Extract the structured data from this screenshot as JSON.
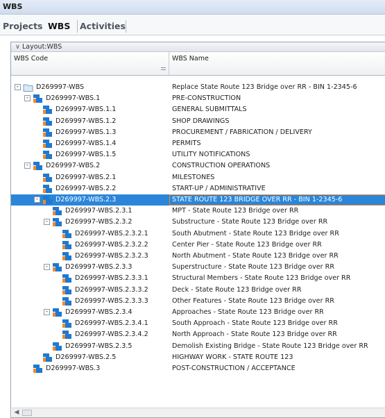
{
  "window": {
    "title": "WBS"
  },
  "tabs": [
    {
      "label": "Projects",
      "active": false
    },
    {
      "label": "WBS",
      "active": true
    },
    {
      "label": "Activities",
      "active": false
    }
  ],
  "panel": {
    "layout_label": "Layout:WBS",
    "columns": {
      "code": "WBS Code",
      "name": "WBS Name"
    }
  },
  "colors": {
    "selection": "#2b86da",
    "selection_outline": "#f08a2c"
  },
  "rows": [
    {
      "code": "D269997-WBS",
      "name": "Replace State Route 123 Bridge over RR - BIN 1-2345-6",
      "level": 0,
      "toggle": "-",
      "icon": "folder-icon",
      "selected": false
    },
    {
      "code": "D269997-WBS.1",
      "name": "PRE-CONSTRUCTION",
      "level": 1,
      "toggle": "-",
      "icon": "wbs-node-icon",
      "selected": false
    },
    {
      "code": "D269997-WBS.1.1",
      "name": "GENERAL SUBMITTALS",
      "level": 2,
      "toggle": "",
      "icon": "wbs-node-icon",
      "selected": false
    },
    {
      "code": "D269997-WBS.1.2",
      "name": "SHOP DRAWINGS",
      "level": 2,
      "toggle": "",
      "icon": "wbs-node-icon",
      "selected": false
    },
    {
      "code": "D269997-WBS.1.3",
      "name": "PROCUREMENT / FABRICATION / DELIVERY",
      "level": 2,
      "toggle": "",
      "icon": "wbs-node-icon",
      "selected": false
    },
    {
      "code": "D269997-WBS.1.4",
      "name": "PERMITS",
      "level": 2,
      "toggle": "",
      "icon": "wbs-node-icon",
      "selected": false
    },
    {
      "code": "D269997-WBS.1.5",
      "name": "UTILITY NOTIFICATIONS",
      "level": 2,
      "toggle": "",
      "icon": "wbs-node-icon",
      "selected": false
    },
    {
      "code": "D269997-WBS.2",
      "name": "CONSTRUCTION OPERATIONS",
      "level": 1,
      "toggle": "-",
      "icon": "wbs-node-icon",
      "selected": false
    },
    {
      "code": "D269997-WBS.2.1",
      "name": "MILESTONES",
      "level": 2,
      "toggle": "",
      "icon": "wbs-node-icon",
      "selected": false
    },
    {
      "code": "D269997-WBS.2.2",
      "name": "START-UP / ADMINISTRATIVE",
      "level": 2,
      "toggle": "",
      "icon": "wbs-node-icon",
      "selected": false
    },
    {
      "code": "D269997-WBS.2.3",
      "name": "STATE ROUTE 123 BRIDGE OVER RR - BIN 1-2345-6",
      "level": 2,
      "toggle": "-",
      "icon": "wbs-node-icon",
      "selected": true
    },
    {
      "code": "D269997-WBS.2.3.1",
      "name": "MPT - State Route 123 Bridge over RR",
      "level": 3,
      "toggle": "",
      "icon": "wbs-node-icon",
      "selected": false
    },
    {
      "code": "D269997-WBS.2.3.2",
      "name": "Substructure - State Route 123 Bridge over RR",
      "level": 3,
      "toggle": "-",
      "icon": "wbs-node-icon",
      "selected": false
    },
    {
      "code": "D269997-WBS.2.3.2.1",
      "name": "South Abutment - State Route 123 Bridge over RR",
      "level": 4,
      "toggle": "",
      "icon": "wbs-node-icon",
      "selected": false
    },
    {
      "code": "D269997-WBS.2.3.2.2",
      "name": "Center Pier - State Route 123 Bridge over RR",
      "level": 4,
      "toggle": "",
      "icon": "wbs-node-icon",
      "selected": false
    },
    {
      "code": "D269997-WBS.2.3.2.3",
      "name": "North Abutment - State Route 123 Bridge over RR",
      "level": 4,
      "toggle": "",
      "icon": "wbs-node-icon",
      "selected": false
    },
    {
      "code": "D269997-WBS.2.3.3",
      "name": "Superstructure - State Route 123 Bridge over RR",
      "level": 3,
      "toggle": "-",
      "icon": "wbs-node-icon",
      "selected": false
    },
    {
      "code": "D269997-WBS.2.3.3.1",
      "name": "Structural Members - State Route 123 Bridge over RR",
      "level": 4,
      "toggle": "",
      "icon": "wbs-node-icon",
      "selected": false
    },
    {
      "code": "D269997-WBS.2.3.3.2",
      "name": "Deck - State Route 123 Bridge over RR",
      "level": 4,
      "toggle": "",
      "icon": "wbs-node-icon",
      "selected": false
    },
    {
      "code": "D269997-WBS.2.3.3.3",
      "name": "Other Features - State Route 123 Bridge over RR",
      "level": 4,
      "toggle": "",
      "icon": "wbs-node-icon",
      "selected": false
    },
    {
      "code": "D269997-WBS.2.3.4",
      "name": "Approaches - State Route 123 Bridge over RR",
      "level": 3,
      "toggle": "-",
      "icon": "wbs-node-icon",
      "selected": false
    },
    {
      "code": "D269997-WBS.2.3.4.1",
      "name": "South Approach - State Route 123 Bridge over RR",
      "level": 4,
      "toggle": "",
      "icon": "wbs-node-icon",
      "selected": false
    },
    {
      "code": "D269997-WBS.2.3.4.2",
      "name": "North Approach - State Route 123 Bridge over RR",
      "level": 4,
      "toggle": "",
      "icon": "wbs-node-icon",
      "selected": false
    },
    {
      "code": "D269997-WBS.2.3.5",
      "name": "Demolish Existing Bridge - State Route 123 Bridge over RR",
      "level": 3,
      "toggle": "",
      "icon": "wbs-node-icon",
      "selected": false
    },
    {
      "code": "D269997-WBS.2.5",
      "name": "HIGHWAY WORK - STATE ROUTE 123",
      "level": 2,
      "toggle": "",
      "icon": "wbs-node-icon",
      "selected": false
    },
    {
      "code": "D269997-WBS.3",
      "name": "POST-CONSTRUCTION / ACCEPTANCE",
      "level": 1,
      "toggle": "",
      "icon": "wbs-node-icon",
      "selected": false
    }
  ]
}
